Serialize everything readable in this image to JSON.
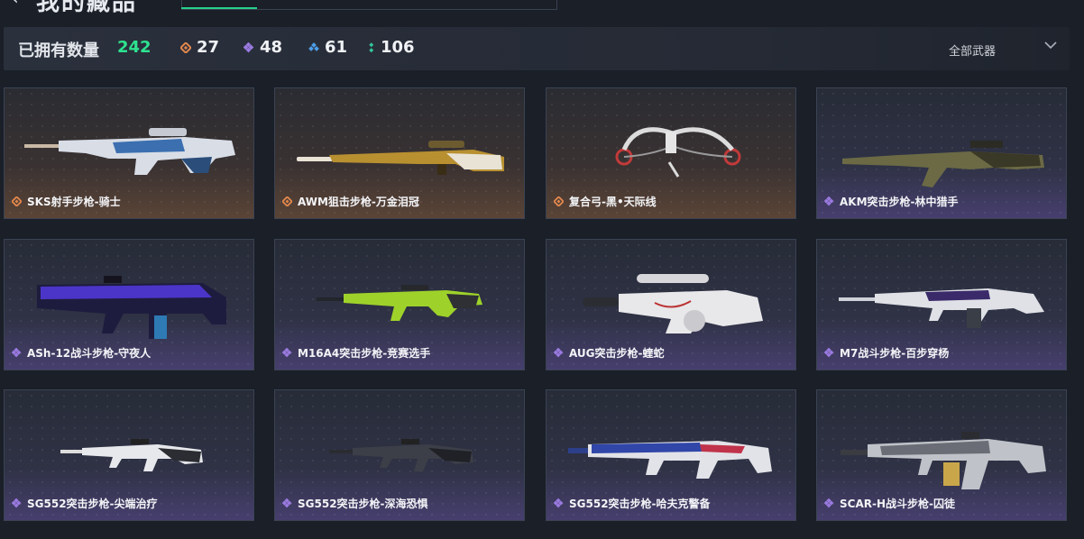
{
  "header": {
    "title": "我的藏品",
    "back_icon": "chevron-left-icon"
  },
  "summary": {
    "owned_label": "已拥有数量",
    "owned_count": "242",
    "stats": [
      {
        "icon": "orange-rarity-icon",
        "value": "27",
        "color": "#e1874d"
      },
      {
        "icon": "purple-rarity-icon",
        "value": "48",
        "color": "#9a7ae0"
      },
      {
        "icon": "blue-rarity-icon",
        "value": "61",
        "color": "#4d9de8"
      },
      {
        "icon": "green-rarity-icon",
        "value": "106",
        "color": "#33c69a"
      }
    ],
    "filter_label": "全部武器"
  },
  "items": [
    {
      "name": "SKS射手步枪-骑士",
      "rarity": "orange"
    },
    {
      "name": "AWM狙击步枪-万金泪冠",
      "rarity": "orange"
    },
    {
      "name": "复合弓-黑•天际线",
      "rarity": "orange"
    },
    {
      "name": "AKM突击步枪-林中猎手",
      "rarity": "purple"
    },
    {
      "name": "ASh-12战斗步枪-守夜人",
      "rarity": "purple"
    },
    {
      "name": "M16A4突击步枪-竞赛选手",
      "rarity": "purple"
    },
    {
      "name": "AUG突击步枪-蝰蛇",
      "rarity": "purple"
    },
    {
      "name": "M7战斗步枪-百步穿杨",
      "rarity": "purple"
    },
    {
      "name": "SG552突击步枪-尖端治疗",
      "rarity": "purple"
    },
    {
      "name": "SG552突击步枪-深海恐惧",
      "rarity": "purple"
    },
    {
      "name": "SG552突击步枪-哈夫克警备",
      "rarity": "purple"
    },
    {
      "name": "SCAR-H战斗步枪-囚徒",
      "rarity": "purple"
    }
  ],
  "colors": {
    "accent_green": "#2ee28f",
    "orange_rarity": "#e1874d",
    "purple_rarity": "#9a7ae0"
  }
}
